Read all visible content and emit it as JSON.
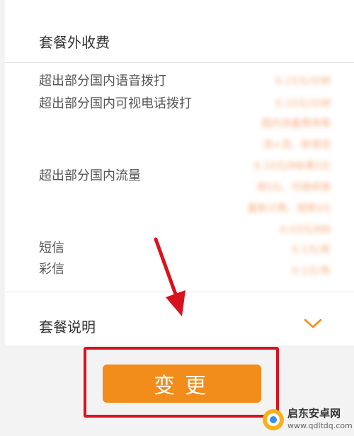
{
  "sections": {
    "extra_fees_title": "套餐外收费",
    "plan_description_title": "套餐说明"
  },
  "fee_items": {
    "voice": {
      "label": "超出部分国内语音拨打",
      "value": "0.15元/分钟"
    },
    "video": {
      "label": "超出部分国内可视电话拨打",
      "value": "0.15元/分钟"
    },
    "video_note": {
      "value_line1": "国内流量费用等",
      "value_line2": "流+流、新增资"
    },
    "data": {
      "label": "超出部分国内流量",
      "value_line1": "0.10元/MB满3元",
      "value_line2": "按1G，可继续使",
      "value_line3": "量新计费，按照1G",
      "value_line4": "0.03元/MB"
    },
    "sms": {
      "label": "短信",
      "value": "0.1元/条"
    },
    "mms": {
      "label": "彩信",
      "value": "0.1元/条"
    }
  },
  "actions": {
    "change_label": "变更"
  },
  "watermark": {
    "name": "启东安卓网",
    "url": "www.qdltdq.com"
  },
  "colors": {
    "accent": "#f28c1a",
    "annotation": "#d8121f",
    "blurred_value": "#f5a06a"
  },
  "icons": {
    "expand": "chevron-down-icon",
    "annotation_arrow": "arrow-icon"
  }
}
